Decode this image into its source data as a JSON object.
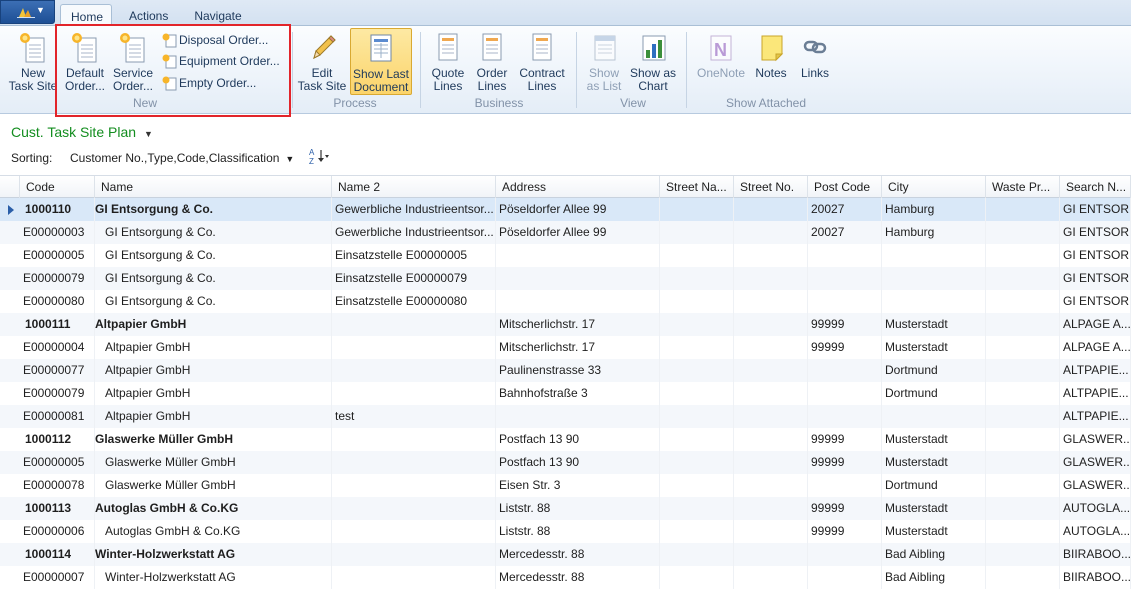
{
  "tabs": [
    "Home",
    "Actions",
    "Navigate"
  ],
  "ribbon": {
    "new_group": {
      "label": "New",
      "buttons": [
        {
          "line1": "New",
          "line2": "Task Site"
        },
        {
          "line1": "Default",
          "line2": "Order..."
        },
        {
          "line1": "Service",
          "line2": "Order..."
        }
      ],
      "small_buttons": [
        "Disposal Order...",
        "Equipment Order...",
        "Empty Order..."
      ]
    },
    "process_group": {
      "label": "Process",
      "buttons": [
        {
          "line1": "Edit",
          "line2": "Task Site"
        },
        {
          "line1": "Show Last",
          "line2": "Document"
        }
      ]
    },
    "business_group": {
      "label": "Business",
      "buttons": [
        {
          "line1": "Quote",
          "line2": "Lines"
        },
        {
          "line1": "Order",
          "line2": "Lines"
        },
        {
          "line1": "Contract",
          "line2": "Lines"
        }
      ]
    },
    "view_group": {
      "label": "View",
      "buttons": [
        {
          "line1": "Show",
          "line2": "as List"
        },
        {
          "line1": "Show as",
          "line2": "Chart"
        }
      ]
    },
    "attached_group": {
      "label": "Show Attached",
      "buttons": [
        {
          "line1": "OneNote",
          "line2": ""
        },
        {
          "line1": "Notes",
          "line2": ""
        },
        {
          "line1": "Links",
          "line2": ""
        }
      ]
    }
  },
  "page": {
    "title": "Cust. Task Site Plan",
    "sorting_label": "Sorting:",
    "sorting_value": "Customer No.,Type,Code,Classification"
  },
  "columns": [
    "Code",
    "Name",
    "Name 2",
    "Address",
    "Street Na...",
    "Street No.",
    "Post Code",
    "City",
    "Waste Pr...",
    "Search N..."
  ],
  "rows": [
    {
      "code": "1000110",
      "name": "GI Entsorgung & Co.",
      "name2": "Gewerbliche Industrieentsor...",
      "address": "Pöseldorfer Allee 99",
      "street_name": "",
      "street_no": "",
      "post_code": "20027",
      "city": "Hamburg",
      "waste": "",
      "search": "GI ENTSOR..."
    },
    {
      "code": "E00000003",
      "name": "GI Entsorgung & Co.",
      "name2": "Gewerbliche Industrieentsor...",
      "address": "Pöseldorfer Allee 99",
      "street_name": "",
      "street_no": "",
      "post_code": "20027",
      "city": "Hamburg",
      "waste": "",
      "search": "GI ENTSOR..."
    },
    {
      "code": "E00000005",
      "name": "GI Entsorgung & Co.",
      "name2": "Einsatzstelle E00000005",
      "address": "",
      "street_name": "",
      "street_no": "",
      "post_code": "",
      "city": "",
      "waste": "",
      "search": "GI ENTSOR..."
    },
    {
      "code": "E00000079",
      "name": "GI Entsorgung & Co.",
      "name2": "Einsatzstelle E00000079",
      "address": "",
      "street_name": "",
      "street_no": "",
      "post_code": "",
      "city": "",
      "waste": "",
      "search": "GI ENTSOR..."
    },
    {
      "code": "E00000080",
      "name": "GI Entsorgung & Co.",
      "name2": "Einsatzstelle E00000080",
      "address": "",
      "street_name": "",
      "street_no": "",
      "post_code": "",
      "city": "",
      "waste": "",
      "search": "GI ENTSOR..."
    },
    {
      "code": "1000111",
      "name": "Altpapier GmbH",
      "name2": "",
      "address": "Mitscherlichstr. 17",
      "street_name": "",
      "street_no": "",
      "post_code": "99999",
      "city": "Musterstadt",
      "waste": "",
      "search": "ALPAGE A..."
    },
    {
      "code": "E00000004",
      "name": "Altpapier GmbH",
      "name2": "",
      "address": "Mitscherlichstr. 17",
      "street_name": "",
      "street_no": "",
      "post_code": "99999",
      "city": "Musterstadt",
      "waste": "",
      "search": "ALPAGE A..."
    },
    {
      "code": "E00000077",
      "name": "Altpapier GmbH",
      "name2": "",
      "address": "Paulinenstrasse 33",
      "street_name": "",
      "street_no": "",
      "post_code": "",
      "city": "Dortmund",
      "waste": "",
      "search": "ALTPAPIE..."
    },
    {
      "code": "E00000079",
      "name": "Altpapier GmbH",
      "name2": "",
      "address": "Bahnhofstraße 3",
      "street_name": "",
      "street_no": "",
      "post_code": "",
      "city": "Dortmund",
      "waste": "",
      "search": "ALTPAPIE..."
    },
    {
      "code": "E00000081",
      "name": "Altpapier GmbH",
      "name2": "test",
      "address": "",
      "street_name": "",
      "street_no": "",
      "post_code": "",
      "city": "",
      "waste": "",
      "search": "ALTPAPIE..."
    },
    {
      "code": "1000112",
      "name": "Glaswerke Müller GmbH",
      "name2": "",
      "address": "Postfach 13 90",
      "street_name": "",
      "street_no": "",
      "post_code": "99999",
      "city": "Musterstadt",
      "waste": "",
      "search": "GLASWER..."
    },
    {
      "code": "E00000005",
      "name": "Glaswerke Müller GmbH",
      "name2": "",
      "address": "Postfach 13 90",
      "street_name": "",
      "street_no": "",
      "post_code": "99999",
      "city": "Musterstadt",
      "waste": "",
      "search": "GLASWER..."
    },
    {
      "code": "E00000078",
      "name": "Glaswerke Müller GmbH",
      "name2": "",
      "address": "Eisen Str. 3",
      "street_name": "",
      "street_no": "",
      "post_code": "",
      "city": "Dortmund",
      "waste": "",
      "search": "GLASWER..."
    },
    {
      "code": "1000113",
      "name": "Autoglas GmbH & Co.KG",
      "name2": "",
      "address": "Liststr. 88",
      "street_name": "",
      "street_no": "",
      "post_code": "99999",
      "city": "Musterstadt",
      "waste": "",
      "search": "AUTOGLA..."
    },
    {
      "code": "E00000006",
      "name": "Autoglas GmbH & Co.KG",
      "name2": "",
      "address": "Liststr. 88",
      "street_name": "",
      "street_no": "",
      "post_code": "99999",
      "city": "Musterstadt",
      "waste": "",
      "search": "AUTOGLA..."
    },
    {
      "code": "1000114",
      "name": "Winter-Holzwerkstatt AG",
      "name2": "",
      "address": "Mercedesstr. 88",
      "street_name": "",
      "street_no": "",
      "post_code": "",
      "city": "Bad Aibling",
      "waste": "",
      "search": "BIIRABOO..."
    },
    {
      "code": "E00000007",
      "name": "Winter-Holzwerkstatt AG",
      "name2": "",
      "address": "Mercedesstr. 88",
      "street_name": "",
      "street_no": "",
      "post_code": "",
      "city": "Bad Aibling",
      "waste": "",
      "search": "BIIRABOO..."
    }
  ],
  "colors": {
    "title_green": "#138d1f",
    "highlight_border": "#e2242a",
    "selected_row": "#d9e8f8"
  }
}
